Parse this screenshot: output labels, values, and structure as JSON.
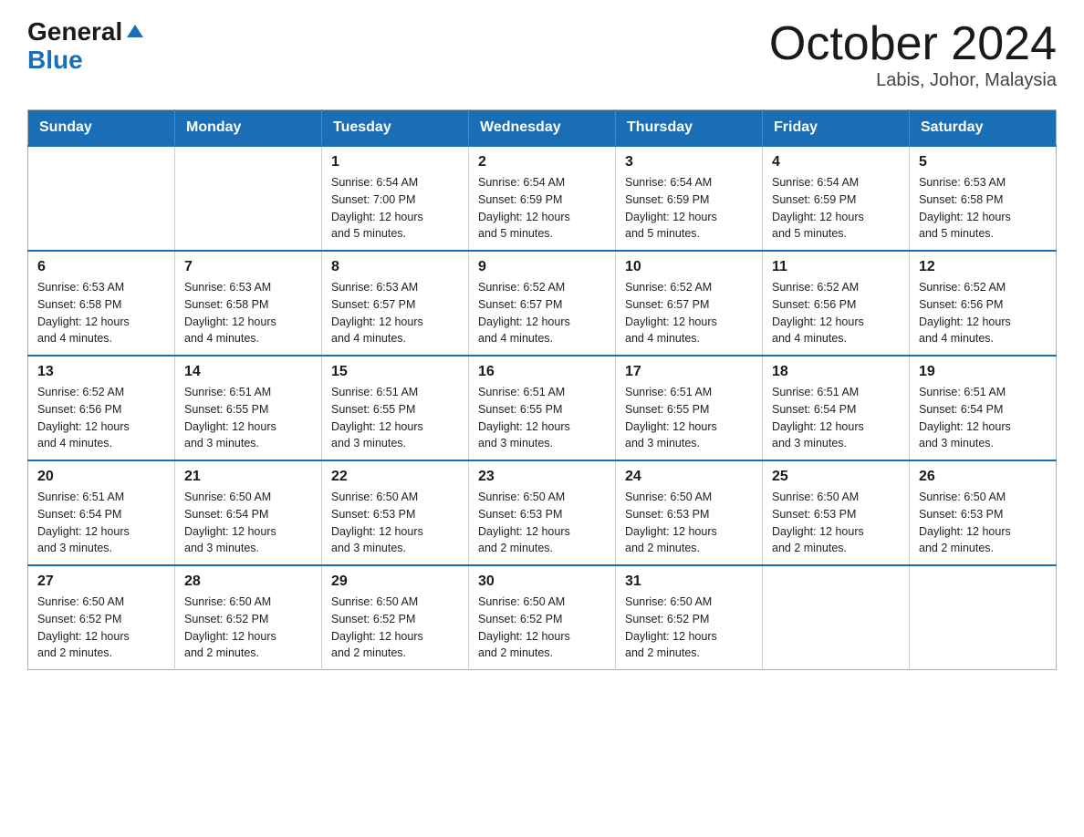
{
  "logo": {
    "general": "General",
    "arrow": "▶",
    "blue": "Blue"
  },
  "title": {
    "month": "October 2024",
    "location": "Labis, Johor, Malaysia"
  },
  "weekdays": [
    "Sunday",
    "Monday",
    "Tuesday",
    "Wednesday",
    "Thursday",
    "Friday",
    "Saturday"
  ],
  "weeks": [
    [
      {
        "day": "",
        "info": ""
      },
      {
        "day": "",
        "info": ""
      },
      {
        "day": "1",
        "info": "Sunrise: 6:54 AM\nSunset: 7:00 PM\nDaylight: 12 hours\nand 5 minutes."
      },
      {
        "day": "2",
        "info": "Sunrise: 6:54 AM\nSunset: 6:59 PM\nDaylight: 12 hours\nand 5 minutes."
      },
      {
        "day": "3",
        "info": "Sunrise: 6:54 AM\nSunset: 6:59 PM\nDaylight: 12 hours\nand 5 minutes."
      },
      {
        "day": "4",
        "info": "Sunrise: 6:54 AM\nSunset: 6:59 PM\nDaylight: 12 hours\nand 5 minutes."
      },
      {
        "day": "5",
        "info": "Sunrise: 6:53 AM\nSunset: 6:58 PM\nDaylight: 12 hours\nand 5 minutes."
      }
    ],
    [
      {
        "day": "6",
        "info": "Sunrise: 6:53 AM\nSunset: 6:58 PM\nDaylight: 12 hours\nand 4 minutes."
      },
      {
        "day": "7",
        "info": "Sunrise: 6:53 AM\nSunset: 6:58 PM\nDaylight: 12 hours\nand 4 minutes."
      },
      {
        "day": "8",
        "info": "Sunrise: 6:53 AM\nSunset: 6:57 PM\nDaylight: 12 hours\nand 4 minutes."
      },
      {
        "day": "9",
        "info": "Sunrise: 6:52 AM\nSunset: 6:57 PM\nDaylight: 12 hours\nand 4 minutes."
      },
      {
        "day": "10",
        "info": "Sunrise: 6:52 AM\nSunset: 6:57 PM\nDaylight: 12 hours\nand 4 minutes."
      },
      {
        "day": "11",
        "info": "Sunrise: 6:52 AM\nSunset: 6:56 PM\nDaylight: 12 hours\nand 4 minutes."
      },
      {
        "day": "12",
        "info": "Sunrise: 6:52 AM\nSunset: 6:56 PM\nDaylight: 12 hours\nand 4 minutes."
      }
    ],
    [
      {
        "day": "13",
        "info": "Sunrise: 6:52 AM\nSunset: 6:56 PM\nDaylight: 12 hours\nand 4 minutes."
      },
      {
        "day": "14",
        "info": "Sunrise: 6:51 AM\nSunset: 6:55 PM\nDaylight: 12 hours\nand 3 minutes."
      },
      {
        "day": "15",
        "info": "Sunrise: 6:51 AM\nSunset: 6:55 PM\nDaylight: 12 hours\nand 3 minutes."
      },
      {
        "day": "16",
        "info": "Sunrise: 6:51 AM\nSunset: 6:55 PM\nDaylight: 12 hours\nand 3 minutes."
      },
      {
        "day": "17",
        "info": "Sunrise: 6:51 AM\nSunset: 6:55 PM\nDaylight: 12 hours\nand 3 minutes."
      },
      {
        "day": "18",
        "info": "Sunrise: 6:51 AM\nSunset: 6:54 PM\nDaylight: 12 hours\nand 3 minutes."
      },
      {
        "day": "19",
        "info": "Sunrise: 6:51 AM\nSunset: 6:54 PM\nDaylight: 12 hours\nand 3 minutes."
      }
    ],
    [
      {
        "day": "20",
        "info": "Sunrise: 6:51 AM\nSunset: 6:54 PM\nDaylight: 12 hours\nand 3 minutes."
      },
      {
        "day": "21",
        "info": "Sunrise: 6:50 AM\nSunset: 6:54 PM\nDaylight: 12 hours\nand 3 minutes."
      },
      {
        "day": "22",
        "info": "Sunrise: 6:50 AM\nSunset: 6:53 PM\nDaylight: 12 hours\nand 3 minutes."
      },
      {
        "day": "23",
        "info": "Sunrise: 6:50 AM\nSunset: 6:53 PM\nDaylight: 12 hours\nand 2 minutes."
      },
      {
        "day": "24",
        "info": "Sunrise: 6:50 AM\nSunset: 6:53 PM\nDaylight: 12 hours\nand 2 minutes."
      },
      {
        "day": "25",
        "info": "Sunrise: 6:50 AM\nSunset: 6:53 PM\nDaylight: 12 hours\nand 2 minutes."
      },
      {
        "day": "26",
        "info": "Sunrise: 6:50 AM\nSunset: 6:53 PM\nDaylight: 12 hours\nand 2 minutes."
      }
    ],
    [
      {
        "day": "27",
        "info": "Sunrise: 6:50 AM\nSunset: 6:52 PM\nDaylight: 12 hours\nand 2 minutes."
      },
      {
        "day": "28",
        "info": "Sunrise: 6:50 AM\nSunset: 6:52 PM\nDaylight: 12 hours\nand 2 minutes."
      },
      {
        "day": "29",
        "info": "Sunrise: 6:50 AM\nSunset: 6:52 PM\nDaylight: 12 hours\nand 2 minutes."
      },
      {
        "day": "30",
        "info": "Sunrise: 6:50 AM\nSunset: 6:52 PM\nDaylight: 12 hours\nand 2 minutes."
      },
      {
        "day": "31",
        "info": "Sunrise: 6:50 AM\nSunset: 6:52 PM\nDaylight: 12 hours\nand 2 minutes."
      },
      {
        "day": "",
        "info": ""
      },
      {
        "day": "",
        "info": ""
      }
    ]
  ]
}
